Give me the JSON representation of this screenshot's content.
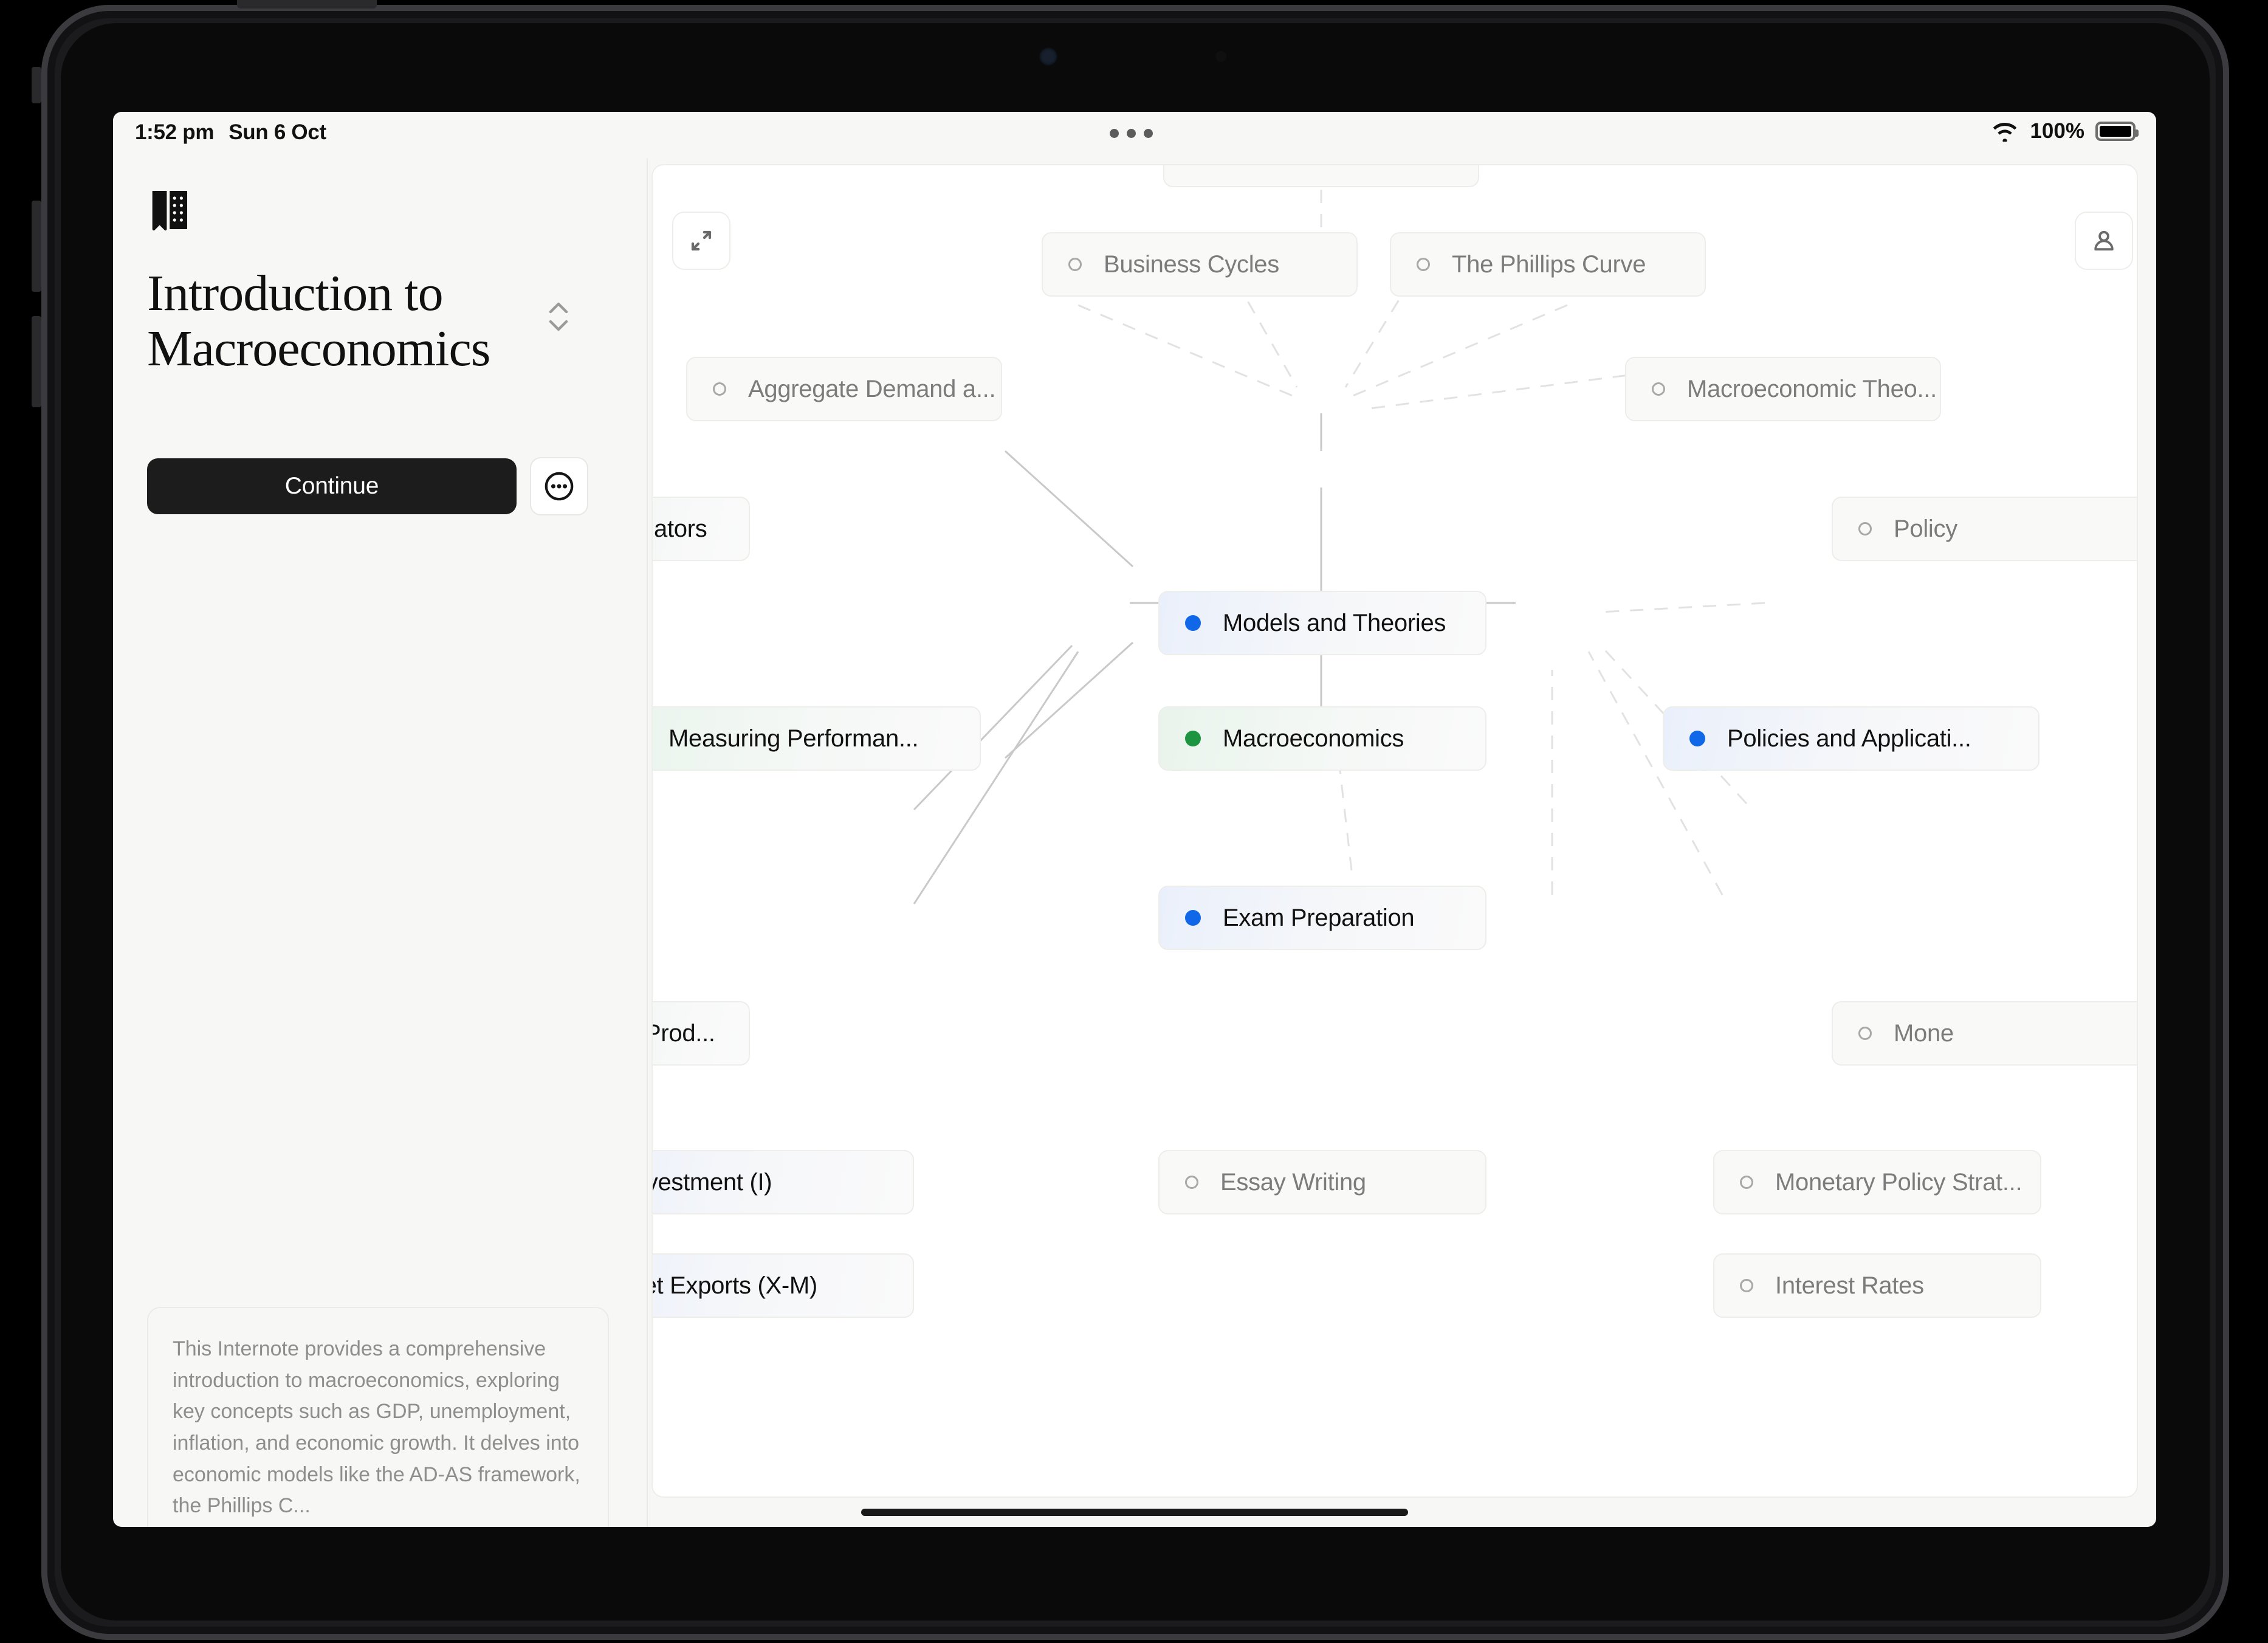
{
  "statusbar": {
    "time": "1:52 pm",
    "date": "Sun 6 Oct",
    "battery_percent": "100%",
    "wifi_icon": "wifi-icon",
    "battery_icon": "battery-full-icon"
  },
  "sidebar": {
    "logo_icon": "open-book-icon",
    "title": "Introduction to Macroeconomics",
    "sort_icon": "chevron-up-down-icon",
    "continue_label": "Continue",
    "more_icon": "ellipsis-circle-icon",
    "description": "This Internote provides a comprehensive introduction to macroeconomics, exploring key concepts such as GDP, unemployment, inflation, and economic growth. It delves into economic models like the AD-AS framework, the Phillips C...",
    "pager": {
      "dots": [
        {
          "state": "active"
        },
        {
          "state": "empty"
        },
        {
          "state": "empty"
        }
      ],
      "add_label": "+",
      "add_icon": "plus-circle-icon"
    }
  },
  "canvas": {
    "expand_icon": "expand-arrows-icon",
    "account_icon": "person-icon",
    "nodes": [
      {
        "id": "business-cycles",
        "label": "Business Cycles",
        "kind": "leaf"
      },
      {
        "id": "the-phillips-curve",
        "label": "The Phillips Curve",
        "kind": "leaf"
      },
      {
        "id": "aggregate-demand",
        "label": "Aggregate Demand a...",
        "kind": "leaf"
      },
      {
        "id": "macroeconomic-theories",
        "label": "Macroeconomic Theo...",
        "kind": "leaf"
      },
      {
        "id": "indicators",
        "label": "ators",
        "kind": "branch-green"
      },
      {
        "id": "policy",
        "label": "Policy",
        "kind": "leaf"
      },
      {
        "id": "models-and-theories",
        "label": "Models and Theories",
        "kind": "branch-blue"
      },
      {
        "id": "measuring-performance",
        "label": "Measuring Performan...",
        "kind": "branch-green"
      },
      {
        "id": "macroeconomics",
        "label": "Macroeconomics",
        "kind": "branch-green"
      },
      {
        "id": "policies-applications",
        "label": "Policies and Applicati...",
        "kind": "branch-blue"
      },
      {
        "id": "exam-preparation",
        "label": "Exam Preparation",
        "kind": "branch-blue"
      },
      {
        "id": "production",
        "label": "Prod...",
        "kind": "branch-green"
      },
      {
        "id": "money",
        "label": "Mone",
        "kind": "leaf"
      },
      {
        "id": "investment",
        "label": "Investment (I)",
        "kind": "branch-blue"
      },
      {
        "id": "essay-writing",
        "label": "Essay Writing",
        "kind": "leaf"
      },
      {
        "id": "monetary-policy-strat",
        "label": "Monetary Policy Strat...",
        "kind": "leaf"
      },
      {
        "id": "net-exports",
        "label": "Net Exports (X-M)",
        "kind": "branch-blue"
      },
      {
        "id": "interest-rates",
        "label": "Interest Rates",
        "kind": "leaf"
      }
    ]
  },
  "colors": {
    "accent_blue": "#1067e8",
    "accent_green": "#1d9440",
    "button_dark": "#1c1c1c",
    "screen_bg": "#f7f7f5",
    "canvas_bg": "#ffffff",
    "muted_text": "#8e8e8e"
  }
}
